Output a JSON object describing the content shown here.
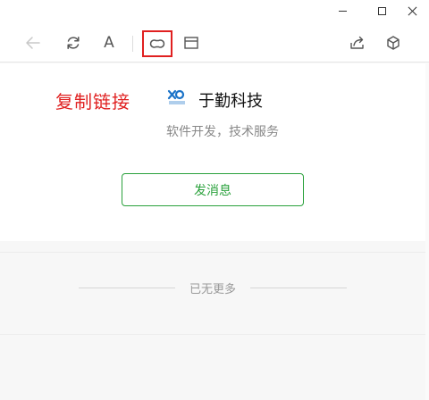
{
  "window": {
    "controls": {
      "minimize": "minimize-icon",
      "maximize": "maximize-icon",
      "close": "close-icon"
    }
  },
  "toolbar": {
    "items": [
      {
        "id": "back",
        "icon": "arrow-left-icon",
        "enabled": false
      },
      {
        "id": "refresh",
        "icon": "refresh-icon"
      },
      {
        "id": "font",
        "icon": "font-size-icon",
        "glyph": "A"
      },
      {
        "id": "copy-link",
        "icon": "link-icon",
        "highlighted": true
      },
      {
        "id": "open-browser",
        "icon": "browser-window-icon"
      },
      {
        "id": "share",
        "icon": "share-icon"
      },
      {
        "id": "mini-program",
        "icon": "cube-icon"
      }
    ],
    "highlight_color": "#e02020"
  },
  "annotation": {
    "text": "复制链接",
    "color": "#e02020"
  },
  "profile": {
    "name": "于勤科技",
    "subtitle": "软件开发，技术服务",
    "logo_icon": "company-logo-icon",
    "message_button": "发消息",
    "accent_color": "#2aa13c"
  },
  "footer": {
    "no_more": "已无更多"
  }
}
